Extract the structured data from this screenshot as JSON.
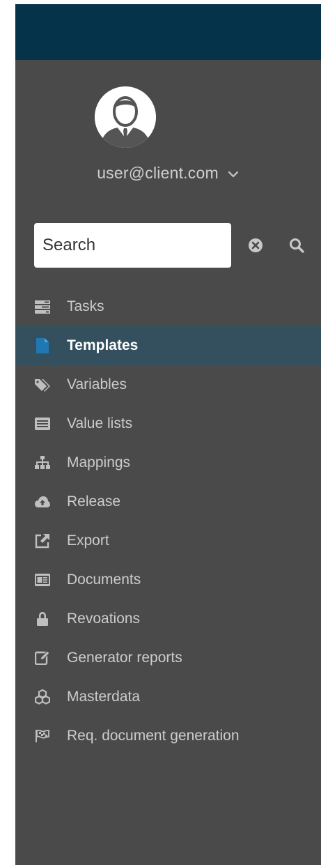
{
  "user": {
    "email": "user@client.com"
  },
  "search": {
    "placeholder": "Search"
  },
  "nav": {
    "items": [
      {
        "label": "Tasks",
        "icon": "tasks-icon",
        "active": false
      },
      {
        "label": "Templates",
        "icon": "file-icon",
        "active": true
      },
      {
        "label": "Variables",
        "icon": "tags-icon",
        "active": false
      },
      {
        "label": "Value lists",
        "icon": "list-icon",
        "active": false
      },
      {
        "label": "Mappings",
        "icon": "sitemap-icon",
        "active": false
      },
      {
        "label": "Release",
        "icon": "cloud-upload-icon",
        "active": false
      },
      {
        "label": "Export",
        "icon": "external-link-icon",
        "active": false
      },
      {
        "label": "Documents",
        "icon": "id-card-icon",
        "active": false
      },
      {
        "label": "Revoations",
        "icon": "lock-icon",
        "active": false
      },
      {
        "label": "Generator reports",
        "icon": "edit-icon",
        "active": false
      },
      {
        "label": "Masterdata",
        "icon": "cubes-icon",
        "active": false
      },
      {
        "label": "Req. document generation",
        "icon": "flag-checkered-icon",
        "active": false
      }
    ]
  },
  "colors": {
    "topbar": "#05334a",
    "sidebar": "#4a4a4a",
    "active_row": "#34505f",
    "active_icon": "#1f78b4",
    "icon": "#bfbfbf",
    "label": "#cccccc"
  }
}
